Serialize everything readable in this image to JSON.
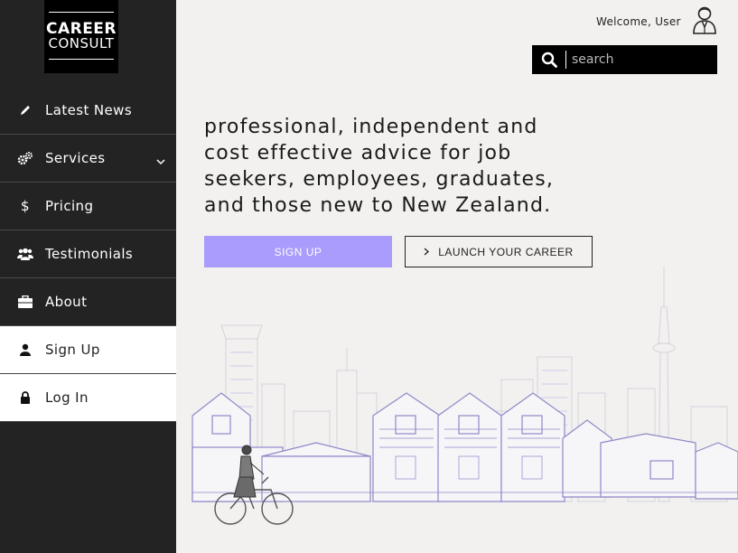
{
  "brand": {
    "line1": "CAREER",
    "line2": "CONSULT"
  },
  "sidebar": {
    "items": [
      {
        "label": "Latest News",
        "icon": "pencil-icon"
      },
      {
        "label": "Services",
        "icon": "cogs-icon"
      },
      {
        "label": "Pricing",
        "icon": "dollar-icon"
      },
      {
        "label": "Testimonials",
        "icon": "users-icon"
      },
      {
        "label": "About",
        "icon": "briefcase-icon"
      },
      {
        "label": "Sign Up",
        "icon": "user-icon"
      },
      {
        "label": "Log In",
        "icon": "lock-icon"
      }
    ]
  },
  "header": {
    "welcome": "Welcome, User",
    "search_placeholder": "search"
  },
  "hero": {
    "headline": "professional, independent and cost effective advice for job seekers, employees, graduates, and those new to New Zealand.",
    "signup_label": "SIGN UP",
    "launch_label": "LAUNCH YOUR CAREER"
  },
  "colors": {
    "sidebar_bg": "#232323",
    "accent": "#a99cfc",
    "page_bg": "#f2f1ef"
  }
}
